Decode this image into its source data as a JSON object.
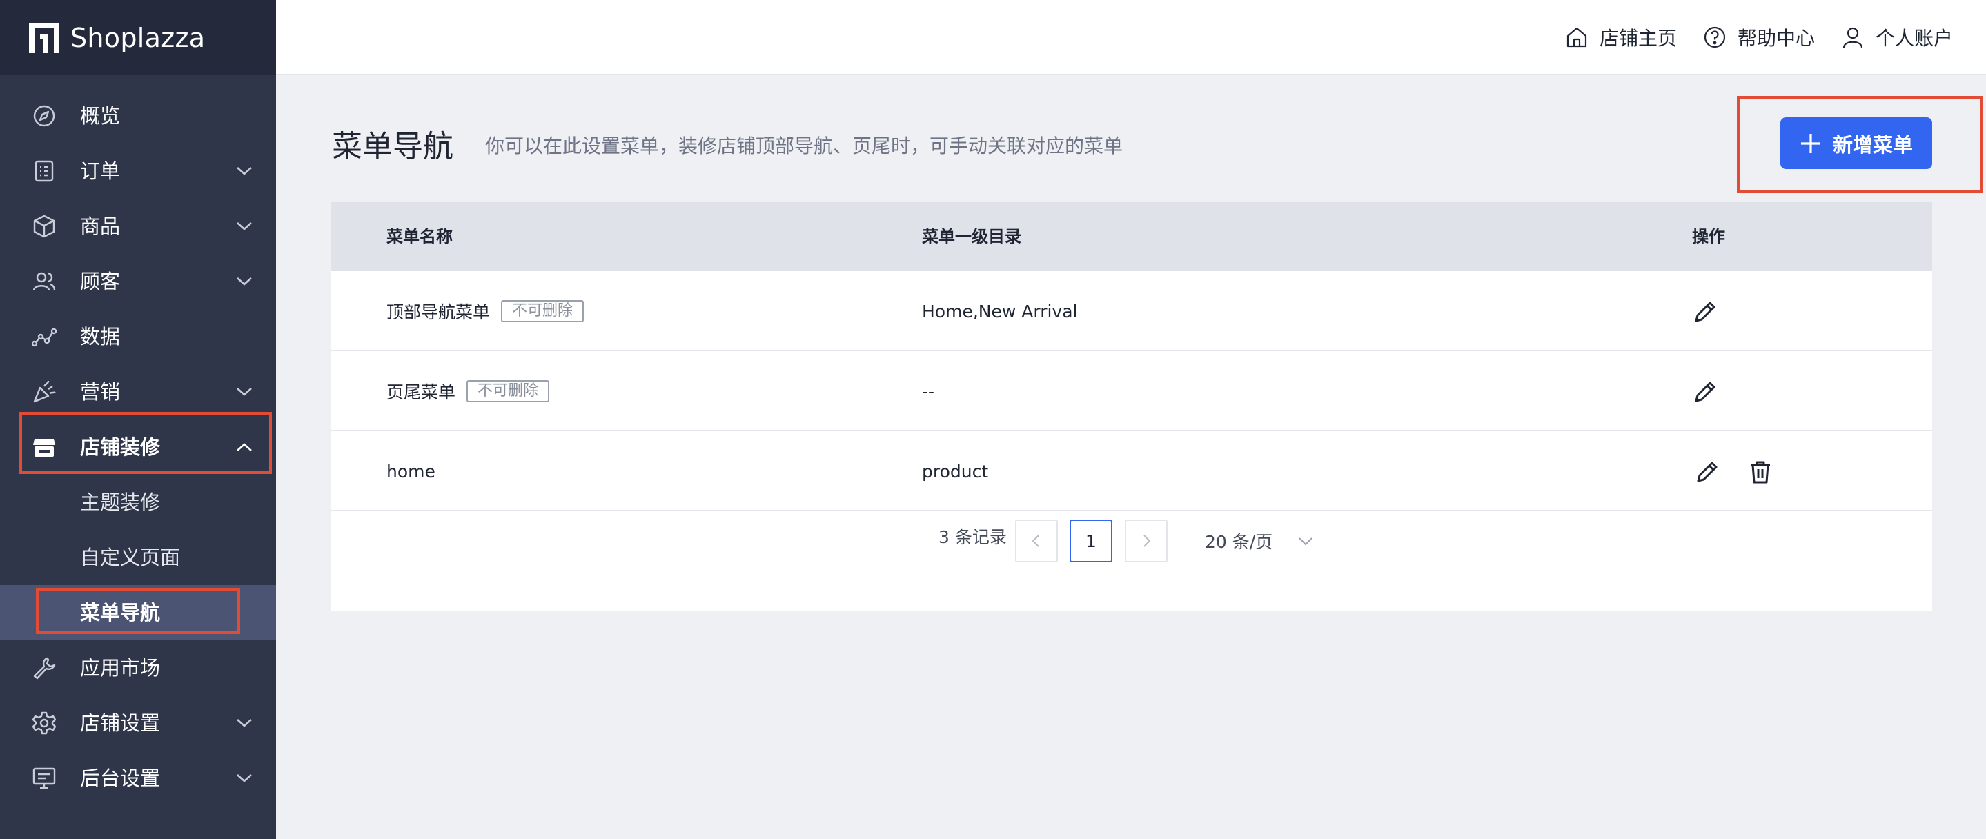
{
  "brand": {
    "name": "Shoplazza"
  },
  "sidebar": {
    "items": [
      {
        "label": "概览",
        "icon": "compass-icon",
        "expandable": false
      },
      {
        "label": "订单",
        "icon": "order-list-icon",
        "expandable": true
      },
      {
        "label": "商品",
        "icon": "product-box-icon",
        "expandable": true
      },
      {
        "label": "顾客",
        "icon": "customers-icon",
        "expandable": true
      },
      {
        "label": "数据",
        "icon": "analytics-icon",
        "expandable": false
      },
      {
        "label": "营销",
        "icon": "marketing-icon",
        "expandable": true
      },
      {
        "label": "店铺装修",
        "icon": "storefront-icon",
        "expandable": true,
        "expanded": true
      },
      {
        "label": "应用市场",
        "icon": "wrench-icon",
        "expandable": false
      },
      {
        "label": "店铺设置",
        "icon": "gear-icon",
        "expandable": true
      },
      {
        "label": "后台设置",
        "icon": "monitor-icon",
        "expandable": true
      }
    ],
    "subitems": [
      {
        "label": "主题装修"
      },
      {
        "label": "自定义页面"
      },
      {
        "label": "菜单导航",
        "selected": true
      }
    ]
  },
  "topbar": {
    "store_home": "店铺主页",
    "help_center": "帮助中心",
    "account": "个人账户"
  },
  "page": {
    "title": "菜单导航",
    "description": "你可以在此设置菜单，装修店铺顶部导航、页尾时，可手动关联对应的菜单",
    "add_button": "新增菜单"
  },
  "table": {
    "headers": {
      "name": "菜单名称",
      "directory": "菜单一级目录",
      "actions": "操作"
    },
    "rows": [
      {
        "name": "顶部导航菜单",
        "tag": "不可删除",
        "directory": "Home,New Arrival",
        "deletable": false
      },
      {
        "name": "页尾菜单",
        "tag": "不可删除",
        "directory": "--",
        "deletable": false
      },
      {
        "name": "home",
        "tag": "",
        "directory": "product",
        "deletable": true
      }
    ]
  },
  "pagination": {
    "total": "3 条记录",
    "current_page": "1",
    "page_size": "20 条/页"
  },
  "colors": {
    "sidebar_bg": "#2f3649",
    "sidebar_selected_bg": "#4b5472",
    "primary": "#3366f0",
    "highlight": "#e24b35",
    "page_bg": "#eff0f4"
  }
}
